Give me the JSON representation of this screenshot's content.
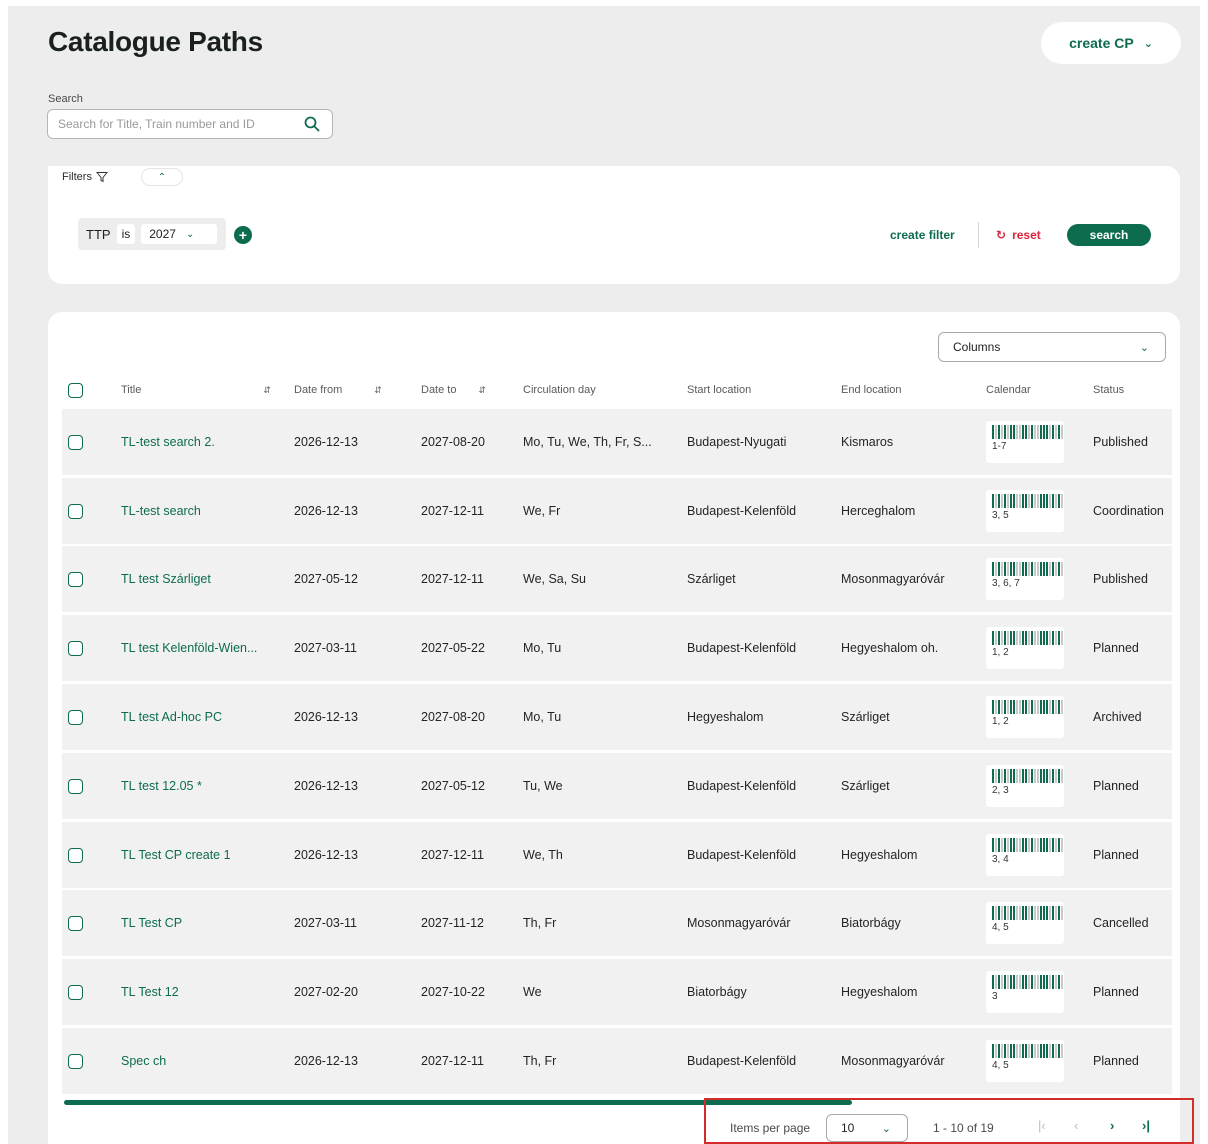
{
  "header": {
    "title": "Catalogue Paths",
    "create_button": "create CP"
  },
  "search": {
    "label": "Search",
    "placeholder": "Search for Title, Train number and ID"
  },
  "filters": {
    "tab_label": "Filters",
    "chip": {
      "field": "TTP",
      "operator": "is",
      "value": "2027"
    },
    "create_filter": "create filter",
    "reset": "reset",
    "search": "search"
  },
  "table": {
    "columns_select": "Columns",
    "headers": {
      "title": "Title",
      "date_from": "Date from",
      "date_to": "Date to",
      "circulation_day": "Circulation day",
      "start_location": "Start location",
      "end_location": "End location",
      "calendar": "Calendar",
      "status": "Status"
    },
    "rows": [
      {
        "title": "TL-test search 2.",
        "date_from": "2026-12-13",
        "date_to": "2027-08-20",
        "circulation_day": "Mo, Tu, We, Th, Fr, S...",
        "start_location": "Budapest-Nyugati",
        "end_location": "Kismaros",
        "calendar": "1-7",
        "status": "Published"
      },
      {
        "title": "TL-test search",
        "date_from": "2026-12-13",
        "date_to": "2027-12-11",
        "circulation_day": "We, Fr",
        "start_location": "Budapest-Kelenföld",
        "end_location": "Herceghalom",
        "calendar": "3, 5",
        "status": "Coordination"
      },
      {
        "title": "TL test Szárliget",
        "date_from": "2027-05-12",
        "date_to": "2027-12-11",
        "circulation_day": "We, Sa, Su",
        "start_location": "Szárliget",
        "end_location": "Mosonmagyaróvár",
        "calendar": "3, 6, 7",
        "status": "Published"
      },
      {
        "title": "TL test Kelenföld-Wien...",
        "date_from": "2027-03-11",
        "date_to": "2027-05-22",
        "circulation_day": "Mo, Tu",
        "start_location": "Budapest-Kelenföld",
        "end_location": "Hegyeshalom oh.",
        "calendar": "1, 2",
        "status": "Planned"
      },
      {
        "title": "TL test Ad-hoc PC",
        "date_from": "2026-12-13",
        "date_to": "2027-08-20",
        "circulation_day": "Mo, Tu",
        "start_location": "Hegyeshalom",
        "end_location": "Szárliget",
        "calendar": "1, 2",
        "status": "Archived"
      },
      {
        "title": "TL test 12.05 *",
        "date_from": "2026-12-13",
        "date_to": "2027-05-12",
        "circulation_day": "Tu, We",
        "start_location": "Budapest-Kelenföld",
        "end_location": "Szárliget",
        "calendar": "2, 3",
        "status": "Planned"
      },
      {
        "title": "TL Test CP create 1",
        "date_from": "2026-12-13",
        "date_to": "2027-12-11",
        "circulation_day": "We, Th",
        "start_location": "Budapest-Kelenföld",
        "end_location": "Hegyeshalom",
        "calendar": "3, 4",
        "status": "Planned"
      },
      {
        "title": "TL Test CP",
        "date_from": "2027-03-11",
        "date_to": "2027-11-12",
        "circulation_day": "Th, Fr",
        "start_location": "Mosonmagyaróvár",
        "end_location": "Biatorbágy",
        "calendar": "4, 5",
        "status": "Cancelled"
      },
      {
        "title": "TL Test 12",
        "date_from": "2027-02-20",
        "date_to": "2027-10-22",
        "circulation_day": "We",
        "start_location": "Biatorbágy",
        "end_location": "Hegyeshalom",
        "calendar": "3",
        "status": "Planned"
      },
      {
        "title": "Spec ch",
        "date_from": "2026-12-13",
        "date_to": "2027-12-11",
        "circulation_day": "Th, Fr",
        "start_location": "Budapest-Kelenföld",
        "end_location": "Mosonmagyaróvár",
        "calendar": "4, 5",
        "status": "Planned"
      }
    ]
  },
  "pagination": {
    "items_per_page_label": "Items per page",
    "items_per_page_value": "10",
    "range": "1 - 10 of 19"
  },
  "colors": {
    "accent": "#0d6b50",
    "danger": "#d7263d",
    "highlight": "#d42b2b"
  }
}
